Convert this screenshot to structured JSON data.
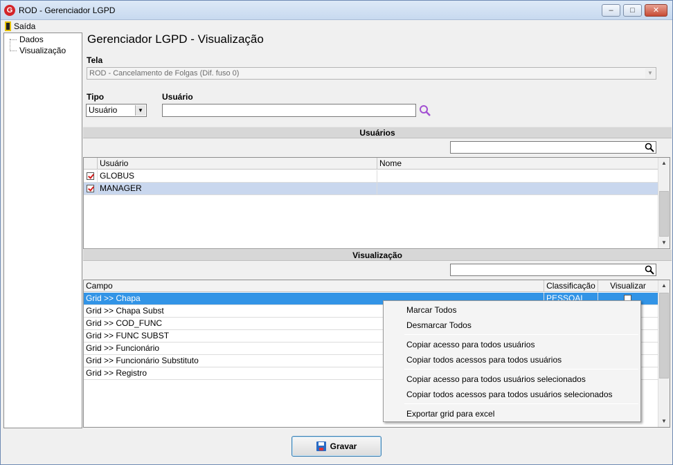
{
  "window": {
    "title": "ROD - Gerenciador LGPD",
    "logo_letter": "G",
    "minimize": "–",
    "maximize": "□",
    "close": "✕"
  },
  "menu": {
    "exit_label": "Saída"
  },
  "tree": {
    "items": [
      "Dados",
      "Visualização"
    ]
  },
  "page": {
    "title": "Gerenciador LGPD - Visualização",
    "tela_label": "Tela",
    "tela_value": "ROD - Cancelamento de Folgas (Dif. fuso 0)",
    "tipo_label": "Tipo",
    "tipo_value": "Usuário",
    "usuario_label": "Usuário",
    "usuario_value": ""
  },
  "users_section": {
    "title": "Usuários",
    "filter_value": "",
    "columns": [
      "Usuário",
      "Nome"
    ],
    "rows": [
      {
        "checked": true,
        "usuario": "GLOBUS",
        "nome": ""
      },
      {
        "checked": true,
        "usuario": "MANAGER",
        "nome": ""
      }
    ]
  },
  "vis_section": {
    "title": "Visualização",
    "filter_value": "",
    "columns": [
      "Campo",
      "Classificação",
      "Visualizar"
    ],
    "rows": [
      {
        "campo": "Grid >> Chapa",
        "classificacao": "PESSOAL"
      },
      {
        "campo": "Grid >> Chapa Subst",
        "classificacao": ""
      },
      {
        "campo": "Grid >> COD_FUNC",
        "classificacao": ""
      },
      {
        "campo": "Grid >> FUNC SUBST",
        "classificacao": ""
      },
      {
        "campo": "Grid >> Funcionário",
        "classificacao": ""
      },
      {
        "campo": "Grid >> Funcionário Substituto",
        "classificacao": ""
      },
      {
        "campo": "Grid >> Registro",
        "classificacao": ""
      }
    ]
  },
  "context_menu": {
    "items": [
      "Marcar Todos",
      "Desmarcar Todos",
      "Copiar acesso para todos usuários",
      "Copiar todos acessos para todos usuários",
      "Copiar acesso para todos usuários selecionados",
      "Copiar todos acessos para todos usuários selecionados",
      "Exportar grid para excel"
    ]
  },
  "footer": {
    "save_label": "Gravar"
  },
  "colors": {
    "selection_blue": "#3294e6",
    "selection_light": "#c9d7ee",
    "check_red": "#d31a1a"
  },
  "icons": [
    "app-logo-icon",
    "exit-door-icon",
    "search-icon",
    "save-icon"
  ]
}
